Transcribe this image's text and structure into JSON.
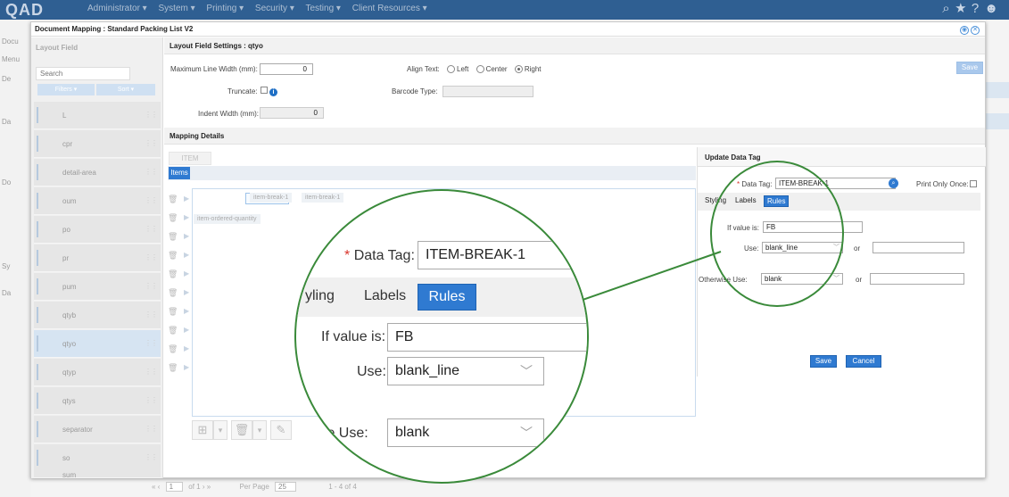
{
  "app": {
    "logo": "QAD",
    "menu": [
      "Administrator ▾",
      "System ▾",
      "Printing ▾",
      "Security ▾",
      "Testing ▾",
      "Client Resources ▾"
    ],
    "left_nav": [
      "Docu",
      "Menu",
      "De",
      "Da",
      "Do",
      "Sy",
      "Da"
    ]
  },
  "dialog": {
    "title": "Document Mapping : Standard Packing List V2"
  },
  "layout_field": {
    "heading": "Layout Field",
    "search_placeholder": "Search",
    "filters_label": "Filters",
    "sort_label": "Sort",
    "items": [
      "L",
      "cpr",
      "detail-area",
      "oum",
      "po",
      "pr",
      "pum",
      "qtyb",
      "qtyo",
      "qtyp",
      "qtys",
      "separator",
      "so",
      "sum"
    ],
    "selected": "qtyo"
  },
  "settings": {
    "heading": "Layout Field Settings : qtyo",
    "max_line_width_label": "Maximum Line Width (mm):",
    "max_line_width_value": "0",
    "align_label": "Align Text:",
    "align_left": "Left",
    "align_center": "Center",
    "align_right": "Right",
    "align_selected": "Right",
    "truncate_label": "Truncate:",
    "barcode_label": "Barcode Type:",
    "indent_label": "Indent Width (mm):",
    "indent_value": "0",
    "save_label": "Save"
  },
  "mapping": {
    "heading": "Mapping Details",
    "tab_label": "ITEM",
    "items_label": "Items",
    "rows": [
      [
        "item-break-1",
        "item-break-1",
        "item-break-1"
      ],
      [
        "item-ordered-quantity"
      ]
    ]
  },
  "update_tag": {
    "heading": "Update Data Tag",
    "data_tag_label": "Data Tag:",
    "data_tag_value": "ITEM-BREAK-1",
    "print_once_label": "Print Only Once:",
    "tabs": [
      "Styling",
      "Labels",
      "Rules"
    ],
    "active_tab": "Rules",
    "if_value_label": "If value is:",
    "if_value": "FB",
    "use_label": "Use:",
    "use_value": "blank_line",
    "or_label": "or",
    "otherwise_label": "Otherwise Use:",
    "otherwise_value": "blank",
    "save_label": "Save",
    "cancel_label": "Cancel"
  },
  "magnifier": {
    "tab_partial_styling": "yling",
    "otherwise_partial": "rwise Use:"
  },
  "pager": {
    "page": "1",
    "of": "of 1",
    "per_page_label": "Per Page",
    "per_page": "25",
    "range": "1 - 4 of 4"
  },
  "colors": {
    "accent": "#2f7ad1",
    "topbar": "#2f5f92",
    "magnifier_ring": "#3a8a3a"
  }
}
